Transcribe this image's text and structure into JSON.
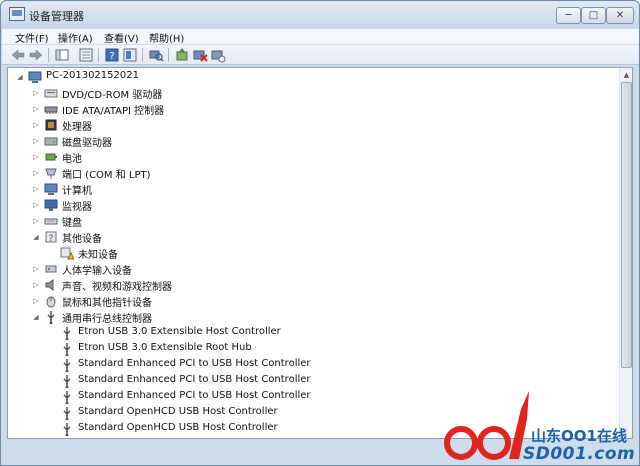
{
  "window": {
    "title": "设备管理器",
    "controls": {
      "minimize": "─",
      "maximize": "□",
      "close": "✕"
    }
  },
  "menu": [
    {
      "label": "文件(F)"
    },
    {
      "label": "操作(A)"
    },
    {
      "label": "查看(V)"
    },
    {
      "label": "帮助(H)"
    }
  ],
  "toolbar": [
    "back-arrow-icon",
    "forward-arrow-icon",
    "properties-pane-icon",
    "list-view-icon",
    "help-icon",
    "console-tree-icon",
    "scan-hardware-icon",
    "update-driver-icon",
    "disable-device-icon",
    "uninstall-device-icon"
  ],
  "tree": {
    "root": "PC-201302152021",
    "items": [
      {
        "label": "DVD/CD-ROM 驱动器",
        "icon": "dvd-drive-icon",
        "expanded": false
      },
      {
        "label": "IDE ATA/ATAPI 控制器",
        "icon": "ide-controller-icon",
        "expanded": false
      },
      {
        "label": "处理器",
        "icon": "processor-icon",
        "expanded": false
      },
      {
        "label": "磁盘驱动器",
        "icon": "disk-drive-icon",
        "expanded": false
      },
      {
        "label": "电池",
        "icon": "battery-icon",
        "expanded": false
      },
      {
        "label": "端口 (COM 和 LPT)",
        "icon": "port-icon",
        "expanded": false
      },
      {
        "label": "计算机",
        "icon": "computer-icon",
        "expanded": false
      },
      {
        "label": "监视器",
        "icon": "monitor-icon",
        "expanded": false
      },
      {
        "label": "键盘",
        "icon": "keyboard-icon",
        "expanded": false
      },
      {
        "label": "其他设备",
        "icon": "other-devices-icon",
        "expanded": true,
        "children": [
          {
            "label": "未知设备",
            "icon": "unknown-device-warning-icon"
          }
        ]
      },
      {
        "label": "人体学输入设备",
        "icon": "hid-icon",
        "expanded": false
      },
      {
        "label": "声音、视频和游戏控制器",
        "icon": "sound-icon",
        "expanded": false
      },
      {
        "label": "鼠标和其他指针设备",
        "icon": "mouse-icon",
        "expanded": false
      },
      {
        "label": "通用串行总线控制器",
        "icon": "usb-icon",
        "expanded": true,
        "children": [
          {
            "label": "Etron USB 3.0 Extensible Host Controller",
            "icon": "usb-device-icon"
          },
          {
            "label": "Etron USB 3.0 Extensible Root Hub",
            "icon": "usb-device-icon"
          },
          {
            "label": "Standard Enhanced PCI to USB Host Controller",
            "icon": "usb-device-icon"
          },
          {
            "label": "Standard Enhanced PCI to USB Host Controller",
            "icon": "usb-device-icon"
          },
          {
            "label": "Standard Enhanced PCI to USB Host Controller",
            "icon": "usb-device-icon"
          },
          {
            "label": "Standard OpenHCD USB Host Controller",
            "icon": "usb-device-icon"
          },
          {
            "label": "Standard OpenHCD USB Host Controller",
            "icon": "usb-device-icon"
          }
        ]
      }
    ]
  },
  "watermark": {
    "brand": "山东OO1在线",
    "site": "SD001.com"
  },
  "colors": {
    "window_frame": "#cfdcec",
    "accent": "#1b62a8",
    "watermark_red": "#e0261c"
  }
}
